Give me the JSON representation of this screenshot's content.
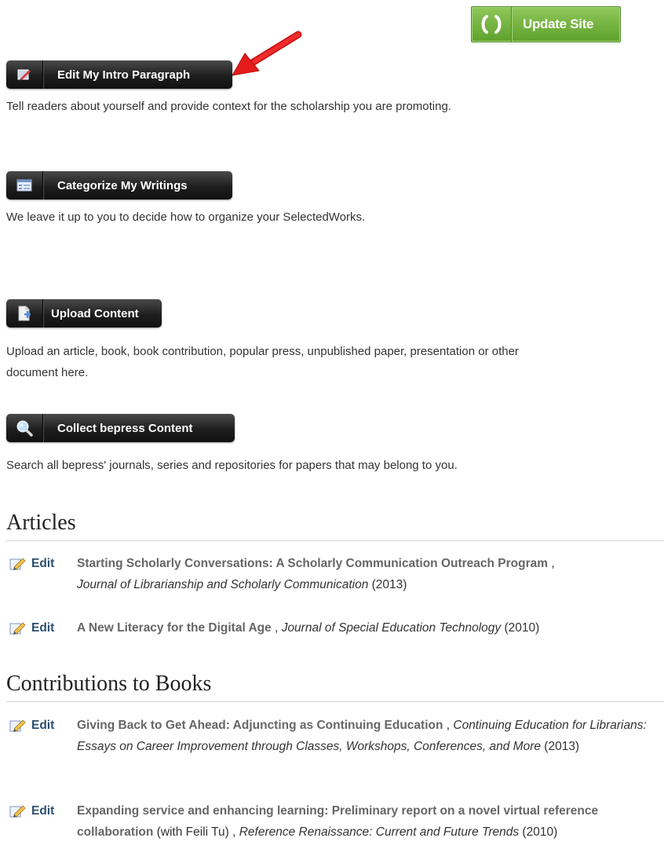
{
  "toolbar": {
    "update_label": "Update Site"
  },
  "actions": [
    {
      "label": "Edit My Intro Paragraph",
      "icon": "edit-intro-icon",
      "desc": "Tell readers about yourself and provide context for the scholarship you are promoting."
    },
    {
      "label": "Categorize My Writings",
      "icon": "categorize-icon",
      "desc": "We leave it up to you to decide how to organize your SelectedWorks."
    },
    {
      "label": "Upload Content",
      "icon": "upload-icon",
      "desc_line1": "Upload an article, book, book contribution, popular press, unpublished paper, presentation or other",
      "desc_line2": "document here."
    },
    {
      "label": "Collect bepress Content",
      "icon": "search-icon",
      "desc": "Search all bepress' journals, series and repositories for papers that may belong to you."
    }
  ],
  "sections": [
    {
      "heading": "Articles",
      "items": [
        {
          "edit": "Edit",
          "title": "Starting Scholarly Conversations: A Scholarly Communication Outreach Program",
          "sep": " , ",
          "journal": "Journal of Librarianship and Scholarly Communication",
          "year": " (2013)"
        },
        {
          "edit": "Edit",
          "title": "A New Literacy for the Digital Age",
          "sep": " , ",
          "journal": "Journal of Special Education Technology",
          "year": " (2010)"
        }
      ]
    },
    {
      "heading": "Contributions to Books",
      "items": [
        {
          "edit": "Edit",
          "title": "Giving Back to Get Ahead: Adjuncting as Continuing Education",
          "sep": " , ",
          "journal": "Continuing Education for Librarians: Essays on Career Improvement through Classes, Workshops, Conferences, and More",
          "year": " (2013)"
        },
        {
          "edit": "Edit",
          "title": "Expanding service and enhancing learning: Preliminary report on a novel virtual reference collaboration",
          "extra": " (with Feili Tu)",
          "sep": " , ",
          "journal": "Reference Renaissance: Current and Future Trends",
          "year": " (2010)"
        }
      ]
    }
  ],
  "colors": {
    "accent_green": "#5ea12c",
    "annotation_arrow": "#e01515",
    "link": "#2c4f6e"
  }
}
